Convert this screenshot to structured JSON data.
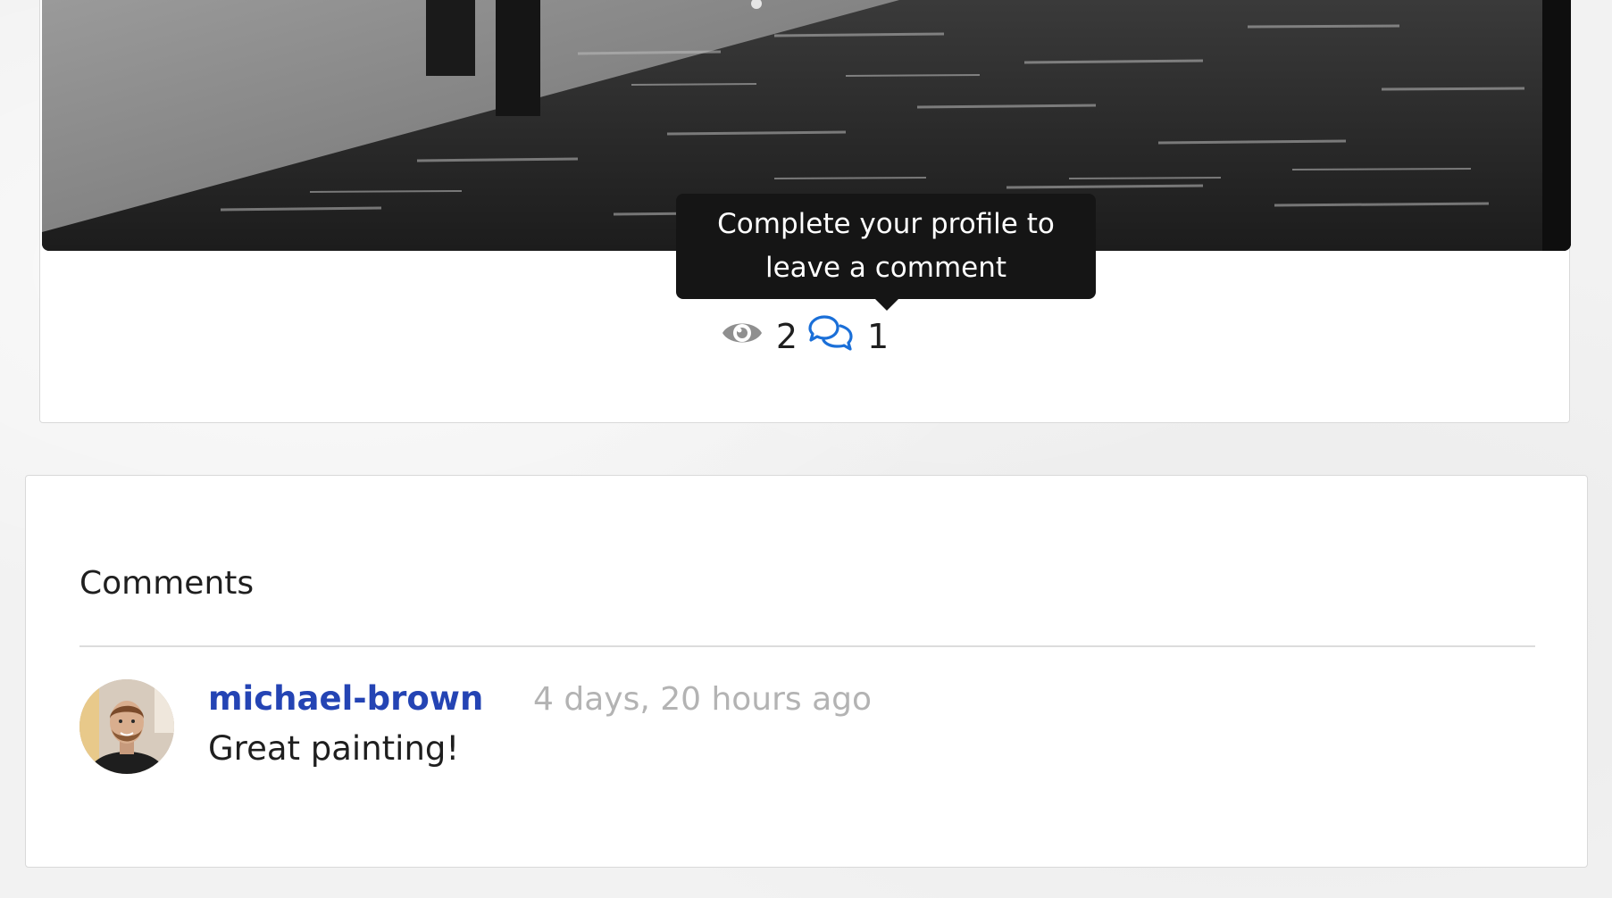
{
  "post": {
    "tooltip": "Complete your profile to leave a comment",
    "views_count": "2",
    "comments_count": "1",
    "icons": {
      "views": "eye-icon",
      "comments": "comments-icon"
    },
    "colors": {
      "comment_icon": "#1a6fd8",
      "eye_icon": "#8f8f8f"
    }
  },
  "comments": {
    "title": "Comments",
    "items": [
      {
        "author": "michael-brown",
        "time": "4 days, 20 hours ago",
        "text": "Great painting!",
        "author_color": "#2444b4"
      }
    ]
  }
}
